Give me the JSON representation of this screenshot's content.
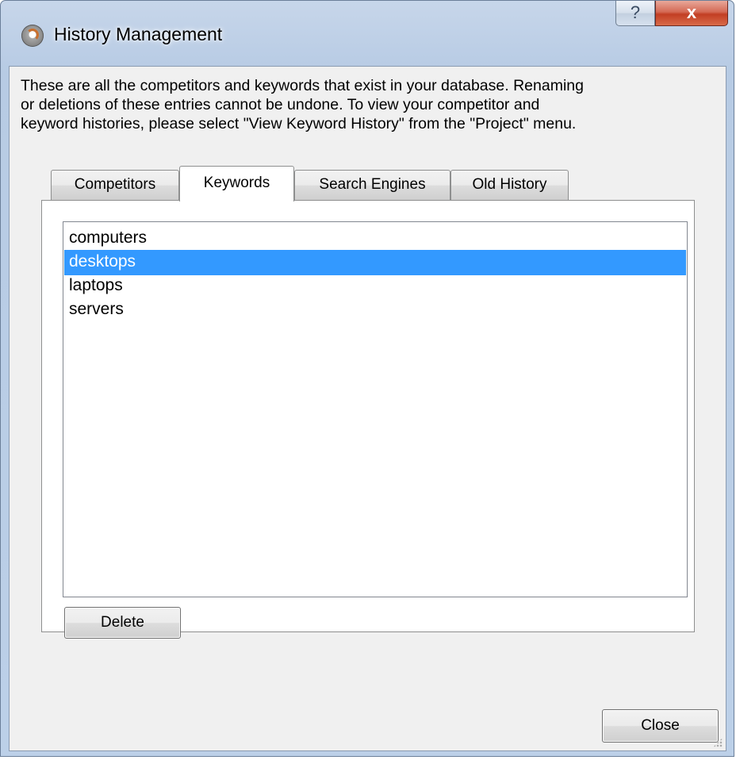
{
  "window": {
    "title": "History Management"
  },
  "titlebar_buttons": {
    "help": "?",
    "close": "x"
  },
  "description": "These are all the competitors and keywords that exist in your database.  Renaming\nor deletions of these entries cannot be undone.  To view your competitor and\nkeyword histories, please select \"View Keyword History\" from the \"Project\" menu.",
  "tabs": [
    {
      "label": "Competitors",
      "active": false
    },
    {
      "label": "Keywords",
      "active": true
    },
    {
      "label": "Search Engines",
      "active": false
    },
    {
      "label": "Old History",
      "active": false
    }
  ],
  "keywords_list": {
    "items": [
      "computers",
      "desktops",
      "laptops",
      "servers"
    ],
    "selected": "desktops"
  },
  "buttons": {
    "delete": "Delete",
    "close": "Close"
  },
  "colors": {
    "selection": "#3399ff",
    "close_button": "#c23e23"
  },
  "icons": [
    "app-icon",
    "help-icon",
    "close-icon",
    "resize-grip-icon"
  ]
}
